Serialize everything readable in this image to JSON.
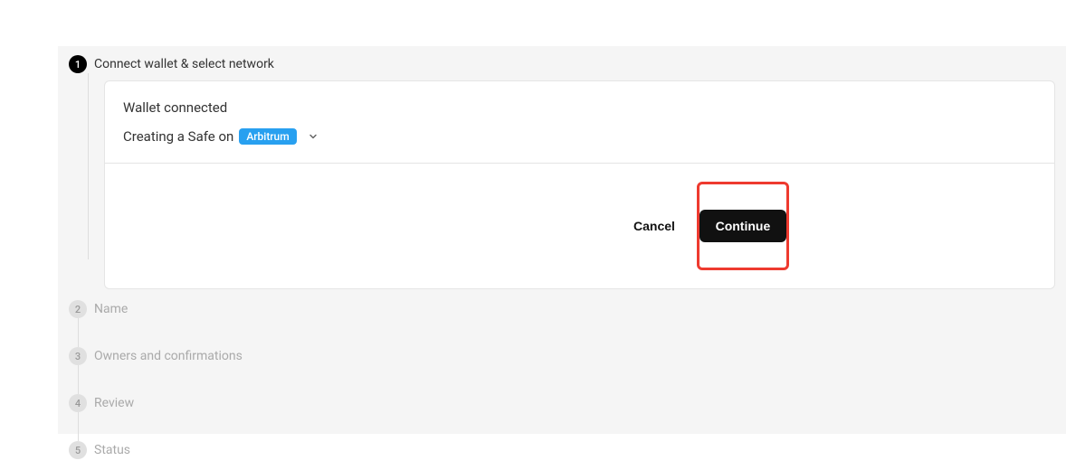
{
  "steps": [
    {
      "number": "1",
      "label": "Connect wallet & select network"
    },
    {
      "number": "2",
      "label": "Name"
    },
    {
      "number": "3",
      "label": "Owners and confirmations"
    },
    {
      "number": "4",
      "label": "Review"
    },
    {
      "number": "5",
      "label": "Status"
    }
  ],
  "card": {
    "wallet_status": "Wallet connected",
    "creating_text": "Creating a Safe on",
    "network_name": "Arbitrum"
  },
  "buttons": {
    "cancel": "Cancel",
    "continue": "Continue"
  },
  "colors": {
    "network_chip": "#28a0f0",
    "highlight_border": "#ee3a2f",
    "primary_button": "#111"
  }
}
